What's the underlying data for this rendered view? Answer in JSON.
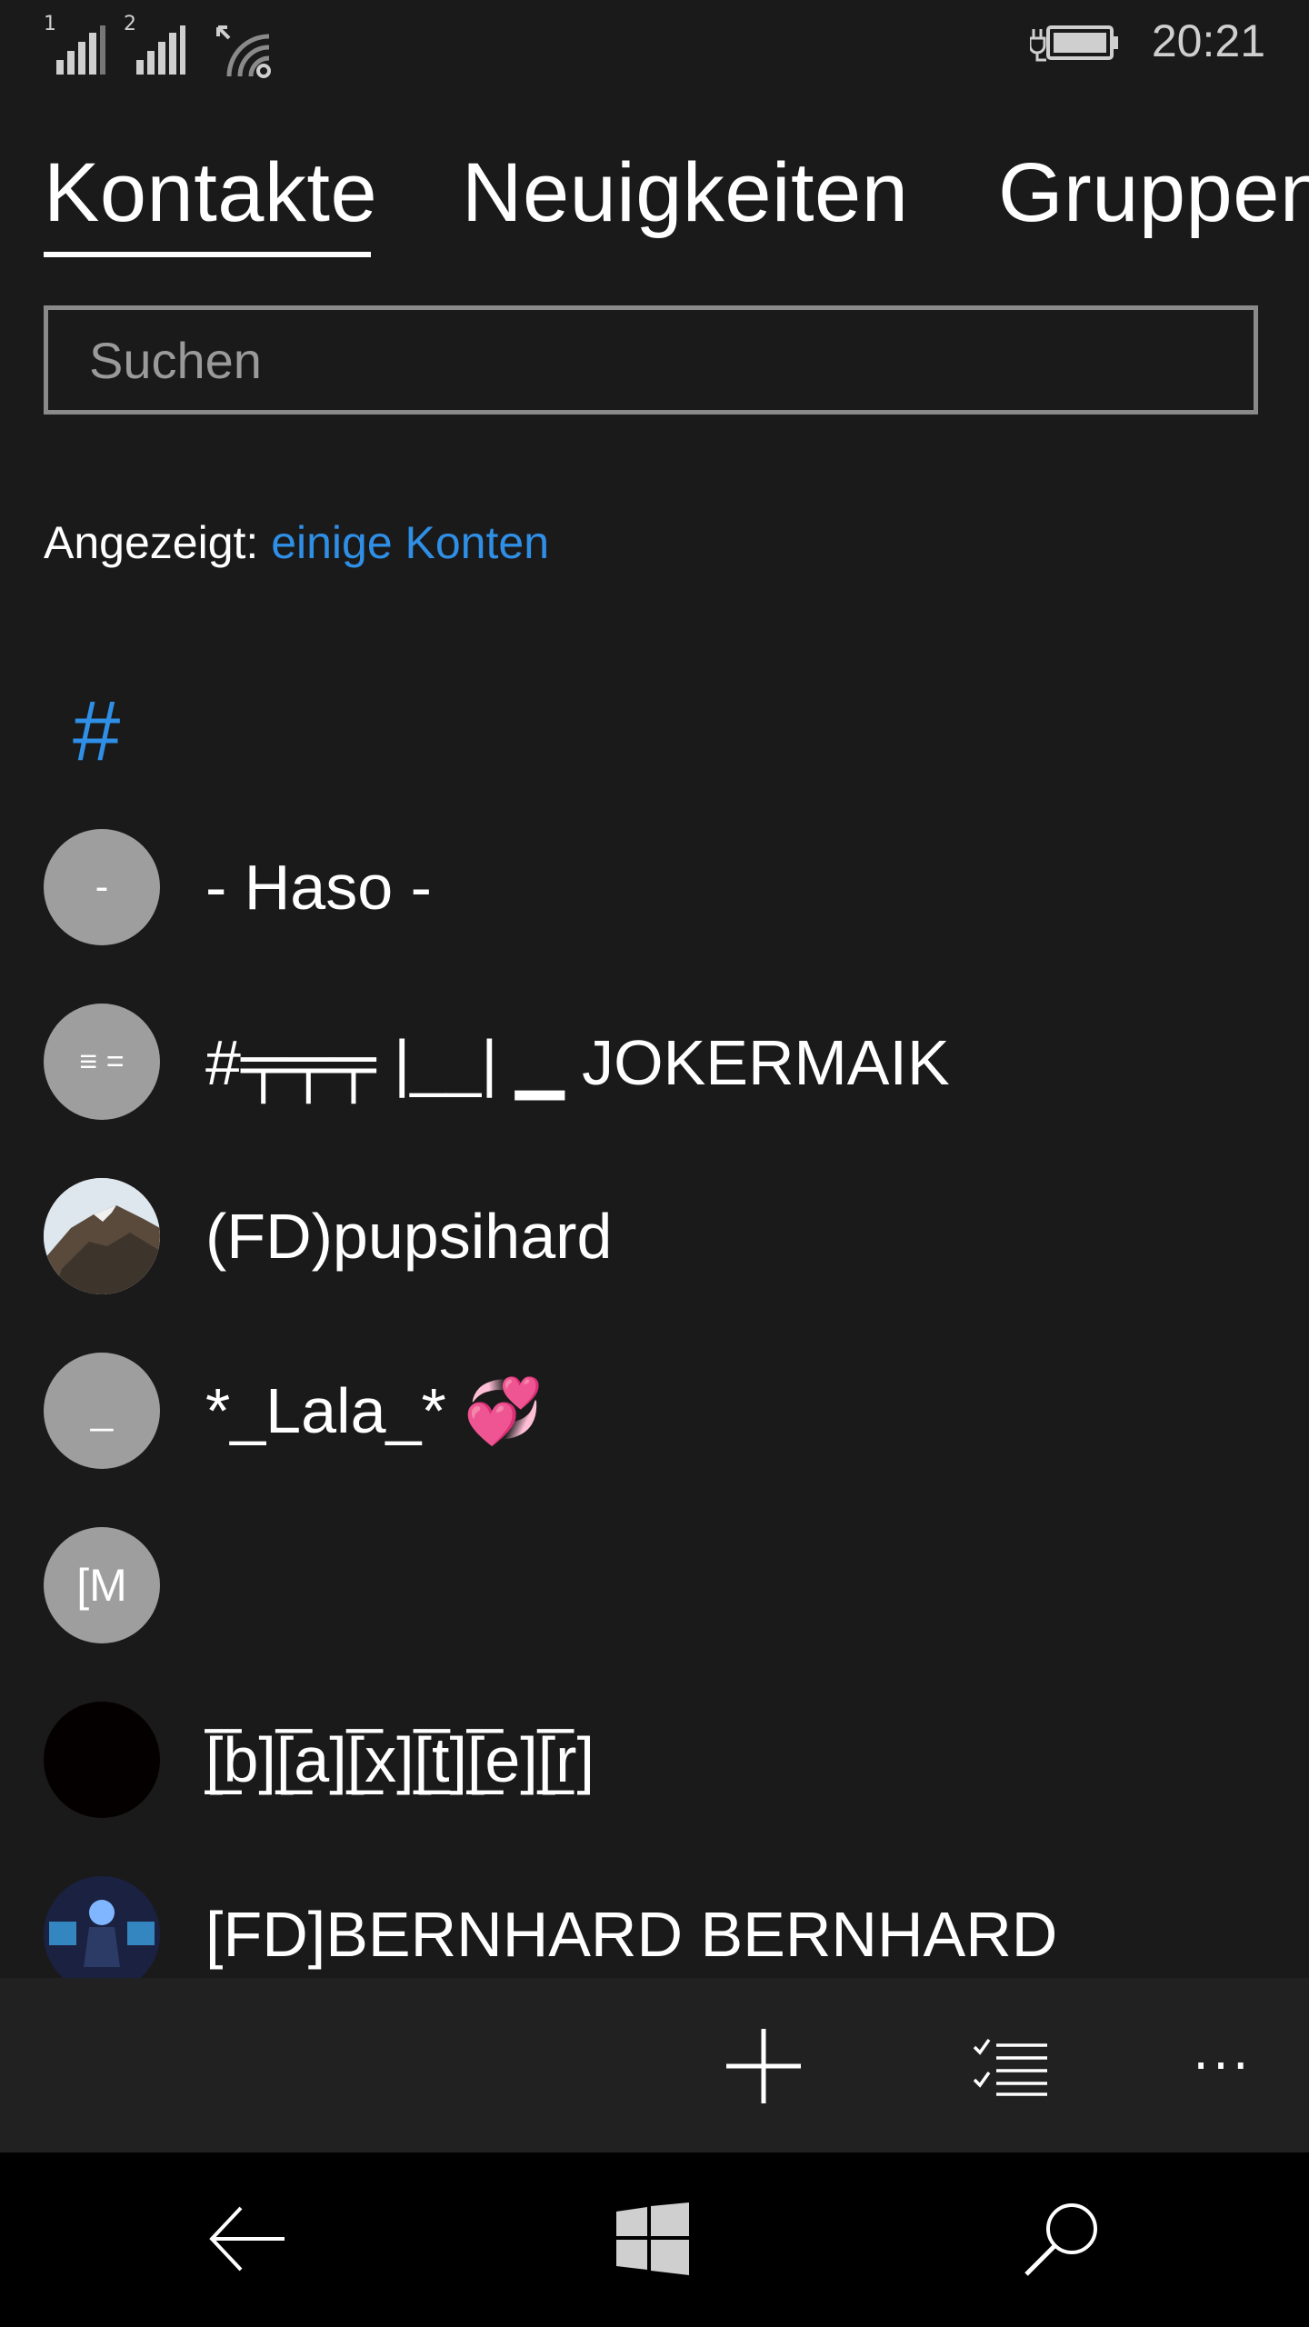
{
  "status_bar": {
    "sim1_label": "1",
    "sim2_label": "2",
    "time": "20:21",
    "icons": [
      "signal-icon",
      "signal-icon",
      "wifi-icon",
      "battery-charging-icon"
    ]
  },
  "pivot": {
    "tabs": [
      {
        "label": "Kontakte",
        "active": true
      },
      {
        "label": "Neuigkeiten",
        "active": false
      },
      {
        "label": "Gruppen",
        "active": false
      }
    ]
  },
  "search": {
    "placeholder": "Suchen",
    "value": ""
  },
  "filter": {
    "prefix": "Angezeigt:",
    "link": "einige Konten"
  },
  "group_header": "#",
  "contacts": [
    {
      "initials": "-",
      "name": "- Haso -"
    },
    {
      "initials": "≡ =",
      "name": "#╤╤╤ |__| ▁ JOKERMAIK"
    },
    {
      "initials": "",
      "name": "(FD)pupsihard"
    },
    {
      "initials": "_",
      "name": "*_Lala_*",
      "emoji": "💞"
    },
    {
      "initials": "[M",
      "name": ""
    },
    {
      "initials": "",
      "name": "[̲̅b][̲̅a][̲̅x][̲̅t][̲̅e][̲̅r]"
    },
    {
      "initials": "",
      "name": "[FD]BERNHARD BERNHARD"
    }
  ],
  "app_bar": {
    "buttons": [
      "add-icon",
      "select-list-icon",
      "more-icon"
    ],
    "more_label": "···"
  },
  "nav_bar": {
    "buttons": [
      "back-icon",
      "windows-icon",
      "search-icon"
    ]
  },
  "colors": {
    "accent": "#2f8fe6",
    "background": "#1a1a1a",
    "app_bar": "#212121",
    "avatar_placeholder": "#9e9e9e"
  }
}
